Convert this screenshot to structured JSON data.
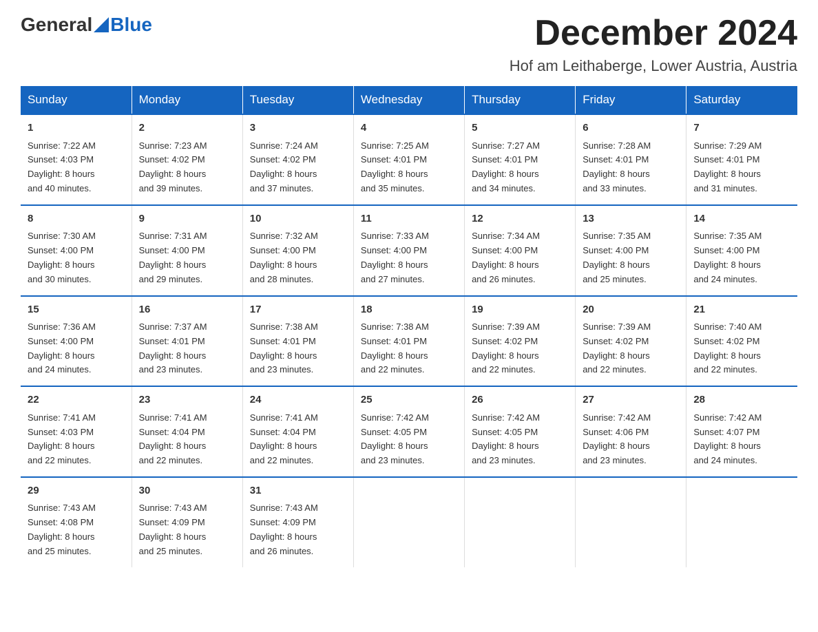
{
  "header": {
    "logo_general": "General",
    "logo_blue": "Blue",
    "month_title": "December 2024",
    "location": "Hof am Leithaberge, Lower Austria, Austria"
  },
  "days_of_week": [
    "Sunday",
    "Monday",
    "Tuesday",
    "Wednesday",
    "Thursday",
    "Friday",
    "Saturday"
  ],
  "weeks": [
    [
      {
        "day": "1",
        "sunrise": "7:22 AM",
        "sunset": "4:03 PM",
        "daylight": "8 hours and 40 minutes."
      },
      {
        "day": "2",
        "sunrise": "7:23 AM",
        "sunset": "4:02 PM",
        "daylight": "8 hours and 39 minutes."
      },
      {
        "day": "3",
        "sunrise": "7:24 AM",
        "sunset": "4:02 PM",
        "daylight": "8 hours and 37 minutes."
      },
      {
        "day": "4",
        "sunrise": "7:25 AM",
        "sunset": "4:01 PM",
        "daylight": "8 hours and 35 minutes."
      },
      {
        "day": "5",
        "sunrise": "7:27 AM",
        "sunset": "4:01 PM",
        "daylight": "8 hours and 34 minutes."
      },
      {
        "day": "6",
        "sunrise": "7:28 AM",
        "sunset": "4:01 PM",
        "daylight": "8 hours and 33 minutes."
      },
      {
        "day": "7",
        "sunrise": "7:29 AM",
        "sunset": "4:01 PM",
        "daylight": "8 hours and 31 minutes."
      }
    ],
    [
      {
        "day": "8",
        "sunrise": "7:30 AM",
        "sunset": "4:00 PM",
        "daylight": "8 hours and 30 minutes."
      },
      {
        "day": "9",
        "sunrise": "7:31 AM",
        "sunset": "4:00 PM",
        "daylight": "8 hours and 29 minutes."
      },
      {
        "day": "10",
        "sunrise": "7:32 AM",
        "sunset": "4:00 PM",
        "daylight": "8 hours and 28 minutes."
      },
      {
        "day": "11",
        "sunrise": "7:33 AM",
        "sunset": "4:00 PM",
        "daylight": "8 hours and 27 minutes."
      },
      {
        "day": "12",
        "sunrise": "7:34 AM",
        "sunset": "4:00 PM",
        "daylight": "8 hours and 26 minutes."
      },
      {
        "day": "13",
        "sunrise": "7:35 AM",
        "sunset": "4:00 PM",
        "daylight": "8 hours and 25 minutes."
      },
      {
        "day": "14",
        "sunrise": "7:35 AM",
        "sunset": "4:00 PM",
        "daylight": "8 hours and 24 minutes."
      }
    ],
    [
      {
        "day": "15",
        "sunrise": "7:36 AM",
        "sunset": "4:00 PM",
        "daylight": "8 hours and 24 minutes."
      },
      {
        "day": "16",
        "sunrise": "7:37 AM",
        "sunset": "4:01 PM",
        "daylight": "8 hours and 23 minutes."
      },
      {
        "day": "17",
        "sunrise": "7:38 AM",
        "sunset": "4:01 PM",
        "daylight": "8 hours and 23 minutes."
      },
      {
        "day": "18",
        "sunrise": "7:38 AM",
        "sunset": "4:01 PM",
        "daylight": "8 hours and 22 minutes."
      },
      {
        "day": "19",
        "sunrise": "7:39 AM",
        "sunset": "4:02 PM",
        "daylight": "8 hours and 22 minutes."
      },
      {
        "day": "20",
        "sunrise": "7:39 AM",
        "sunset": "4:02 PM",
        "daylight": "8 hours and 22 minutes."
      },
      {
        "day": "21",
        "sunrise": "7:40 AM",
        "sunset": "4:02 PM",
        "daylight": "8 hours and 22 minutes."
      }
    ],
    [
      {
        "day": "22",
        "sunrise": "7:41 AM",
        "sunset": "4:03 PM",
        "daylight": "8 hours and 22 minutes."
      },
      {
        "day": "23",
        "sunrise": "7:41 AM",
        "sunset": "4:04 PM",
        "daylight": "8 hours and 22 minutes."
      },
      {
        "day": "24",
        "sunrise": "7:41 AM",
        "sunset": "4:04 PM",
        "daylight": "8 hours and 22 minutes."
      },
      {
        "day": "25",
        "sunrise": "7:42 AM",
        "sunset": "4:05 PM",
        "daylight": "8 hours and 23 minutes."
      },
      {
        "day": "26",
        "sunrise": "7:42 AM",
        "sunset": "4:05 PM",
        "daylight": "8 hours and 23 minutes."
      },
      {
        "day": "27",
        "sunrise": "7:42 AM",
        "sunset": "4:06 PM",
        "daylight": "8 hours and 23 minutes."
      },
      {
        "day": "28",
        "sunrise": "7:42 AM",
        "sunset": "4:07 PM",
        "daylight": "8 hours and 24 minutes."
      }
    ],
    [
      {
        "day": "29",
        "sunrise": "7:43 AM",
        "sunset": "4:08 PM",
        "daylight": "8 hours and 25 minutes."
      },
      {
        "day": "30",
        "sunrise": "7:43 AM",
        "sunset": "4:09 PM",
        "daylight": "8 hours and 25 minutes."
      },
      {
        "day": "31",
        "sunrise": "7:43 AM",
        "sunset": "4:09 PM",
        "daylight": "8 hours and 26 minutes."
      },
      null,
      null,
      null,
      null
    ]
  ],
  "labels": {
    "sunrise": "Sunrise:",
    "sunset": "Sunset:",
    "daylight": "Daylight:"
  }
}
